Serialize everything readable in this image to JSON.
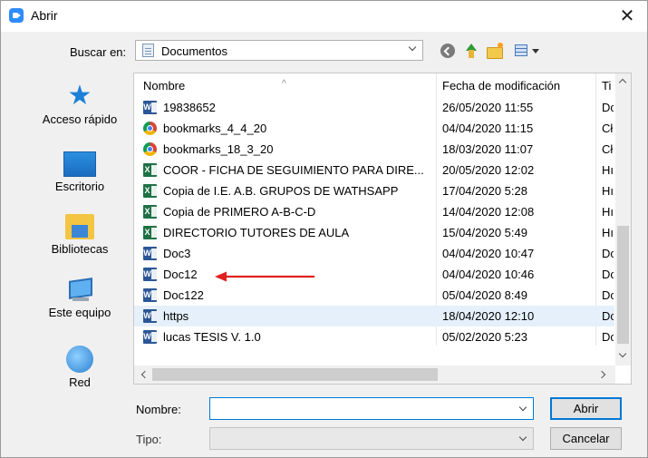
{
  "window": {
    "title": "Abrir",
    "close_symbol": "✕"
  },
  "toolbar": {
    "lookin_label": "Buscar en:",
    "folder": "Documentos",
    "icons": [
      "back-icon",
      "up-folder-icon",
      "new-folder-icon",
      "view-menu-icon"
    ]
  },
  "places": [
    {
      "label": "Acceso rápido",
      "icon": "star-icon"
    },
    {
      "label": "Escritorio",
      "icon": "desktop-icon"
    },
    {
      "label": "Bibliotecas",
      "icon": "library-icon"
    },
    {
      "label": "Este equipo",
      "icon": "computer-icon"
    },
    {
      "label": "Red",
      "icon": "network-icon"
    }
  ],
  "columns": {
    "name": "Nombre",
    "date": "Fecha de modificación",
    "type": "Ti"
  },
  "files": [
    {
      "name": "19838652",
      "date": "26/05/2020 11:55",
      "type": "Dc",
      "icon": "word"
    },
    {
      "name": "bookmarks_4_4_20",
      "date": "04/04/2020 11:15",
      "type": "Cł",
      "icon": "chrome"
    },
    {
      "name": "bookmarks_18_3_20",
      "date": "18/03/2020 11:07",
      "type": "Cł",
      "icon": "chrome"
    },
    {
      "name": "COOR - FICHA DE SEGUIMIENTO PARA DIRE...",
      "date": "20/05/2020 12:02",
      "type": "Hı",
      "icon": "excel"
    },
    {
      "name": "Copia de I.E. A.B.  GRUPOS DE WATHSAPP",
      "date": "17/04/2020 5:28",
      "type": "Hı",
      "icon": "excel"
    },
    {
      "name": "Copia de PRIMERO A-B-C-D",
      "date": "14/04/2020 12:08",
      "type": "Hı",
      "icon": "excel"
    },
    {
      "name": "DIRECTORIO TUTORES DE AULA",
      "date": "15/04/2020 5:49",
      "type": "Hı",
      "icon": "excel"
    },
    {
      "name": "Doc3",
      "date": "04/04/2020 10:47",
      "type": "Dc",
      "icon": "word"
    },
    {
      "name": "Doc12",
      "date": "04/04/2020 10:46",
      "type": "Dc",
      "icon": "word"
    },
    {
      "name": "Doc122",
      "date": "05/04/2020 8:49",
      "type": "Dc",
      "icon": "word"
    },
    {
      "name": "https",
      "date": "18/04/2020 12:10",
      "type": "Dc",
      "icon": "word",
      "selected": true
    },
    {
      "name": "lucas TESIS V. 1.0",
      "date": "05/02/2020 5:23",
      "type": "Dc",
      "icon": "word"
    }
  ],
  "annotation": {
    "color": "#e02020",
    "points_to": "Doc12"
  },
  "form": {
    "name_label": "Nombre:",
    "name_value": "",
    "type_label": "Tipo:",
    "type_value": ""
  },
  "buttons": {
    "open": "Abrir",
    "cancel": "Cancelar"
  },
  "colors": {
    "accent": "#0078d7",
    "selection": "#e5f0fb"
  }
}
